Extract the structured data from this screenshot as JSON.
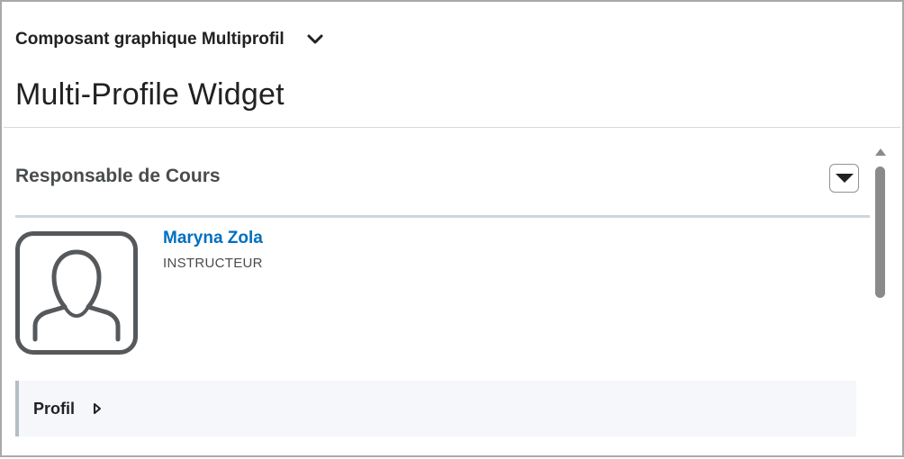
{
  "widget_selector": {
    "title": "Composant graphique Multiprofil",
    "chevron_icon": "chevron-down-icon"
  },
  "page": {
    "title": "Multi-Profile Widget"
  },
  "section": {
    "heading": "Responsable de Cours",
    "collapse_icon": "caret-down-icon"
  },
  "person": {
    "name": "Maryna Zola",
    "role": "INSTRUCTEUR",
    "avatar_icon": "default-user-avatar-icon"
  },
  "profile_panel": {
    "label": "Profil",
    "caret_icon": "caret-right-icon"
  },
  "colors": {
    "link": "#006fbf",
    "text": "#202122",
    "muted": "#494c4e",
    "panel_bg": "#f5f7fb",
    "rule": "#cdd5dc"
  }
}
